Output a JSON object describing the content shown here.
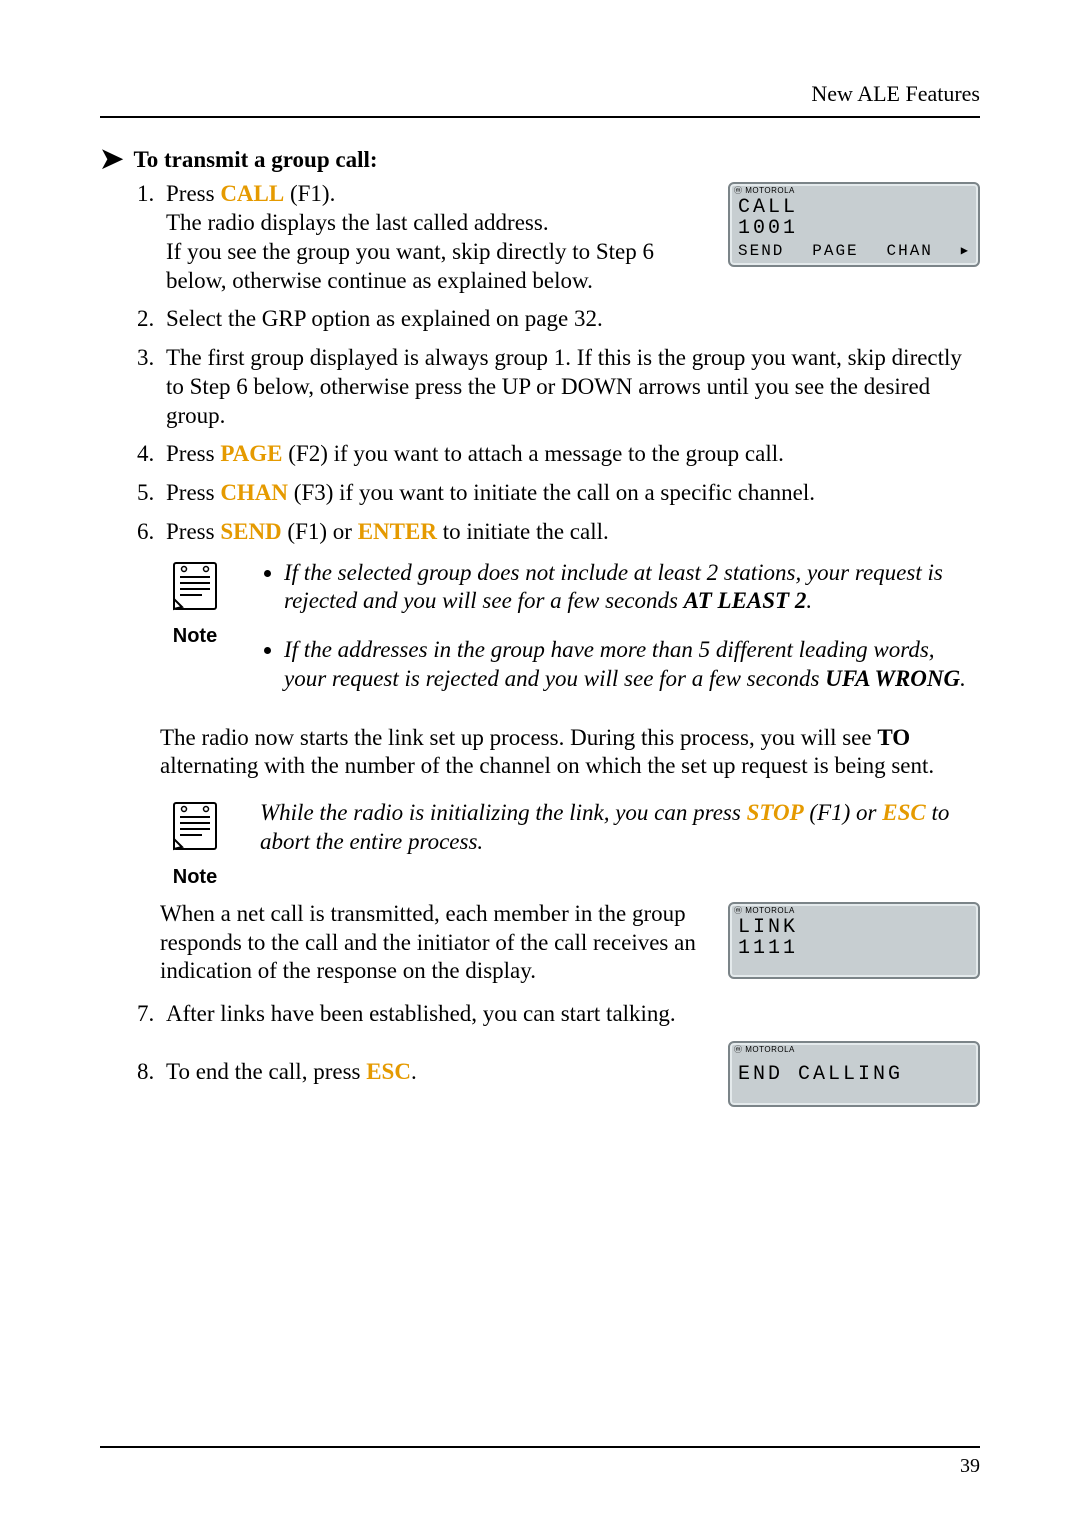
{
  "header": {
    "running": "New ALE Features"
  },
  "section": {
    "title": "To transmit a group call:"
  },
  "keys": {
    "call": "CALL",
    "page": "PAGE",
    "chan": "CHAN",
    "send": "SEND",
    "enter": "ENTER",
    "stop": "STOP",
    "esc": "ESC"
  },
  "steps": {
    "s1": {
      "a": "Press ",
      "a_key": "CALL",
      "a_tail": " (F1).",
      "b": "The radio displays the last called address.",
      "c": "If you see the group you want, skip directly to Step 6 below, otherwise continue as explained below."
    },
    "s2": "Select the GRP option as explained on page 32.",
    "s3": "The first group displayed is always group 1. If this is the group you want, skip directly to Step 6 below, otherwise press the UP or DOWN arrows until you see the desired group.",
    "s4": {
      "pre": "Press ",
      "key": "PAGE",
      "post": " (F2) if you want to attach a message to the group call."
    },
    "s5": {
      "pre": "Press ",
      "key": "CHAN",
      "post": " (F3) if you want to initiate the call on a specific channel."
    },
    "s6": {
      "pre": "Press ",
      "key1": "SEND",
      "mid": " (F1) or ",
      "key2": "ENTER",
      "post": " to initiate the call."
    },
    "s7": "After links have been established, you can start talking.",
    "s8": {
      "pre": "To end the call, press ",
      "key": "ESC",
      "post": "."
    }
  },
  "note1": {
    "label": "Note",
    "items": [
      {
        "txt": "If the selected group does not include at least 2 stations, your request is rejected and you will see for a few seconds ",
        "emph": "AT LEAST 2",
        "tail": "."
      },
      {
        "txt": "If the addresses in the group have more than 5 different leading words, your request is rejected and you will see for a few seconds ",
        "emph": "UFA WRONG",
        "tail": "."
      }
    ]
  },
  "para_to": {
    "a": "The radio now starts the link set up process. During this process, you will see ",
    "b": "TO",
    "c": " alternating with the number of the channel on which the set up request is being sent."
  },
  "note2": {
    "label": "Note",
    "a": "While the radio is initializing the link, you can press ",
    "stop": "STOP",
    "b": " (F1) or ",
    "esc": "ESC",
    "c": " to abort the entire process."
  },
  "para_link": "When a net call is transmitted, each member in the group responds to the call and the initiator of the call receives an indication of the response on the display.",
  "lcd": {
    "brand": "MOTOROLA",
    "call": {
      "line1": "CALL",
      "line2": "1001",
      "sk1": "SEND",
      "sk2": "PAGE",
      "sk3": "CHAN"
    },
    "link": {
      "line1": "LINK",
      "line2": "1111"
    },
    "end": {
      "line1": "END CALLING"
    }
  },
  "page_number": "39"
}
